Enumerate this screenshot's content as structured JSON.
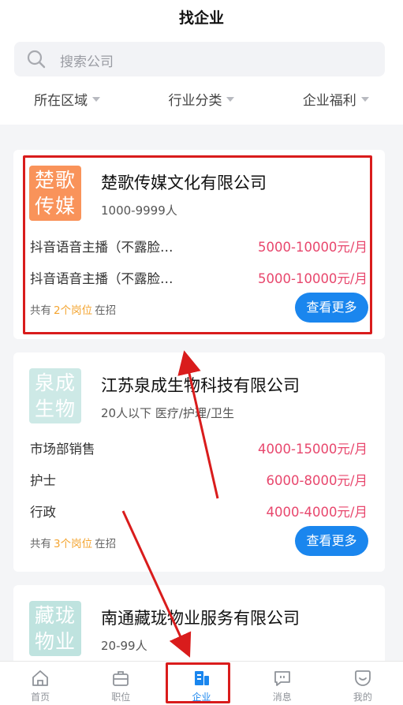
{
  "header": {
    "title": "找企业"
  },
  "search": {
    "placeholder": "搜索公司"
  },
  "filters": [
    {
      "label": "所在区域"
    },
    {
      "label": "行业分类"
    },
    {
      "label": "企业福利"
    }
  ],
  "companies": [
    {
      "logo_line1": "楚歌",
      "logo_line2": "传媒",
      "logo_color": "#f9935a",
      "name": "楚歌传媒文化有限公司",
      "meta": "1000-9999人",
      "jobs": [
        {
          "title": "抖音语音主播（不露脸…",
          "salary": "5000-10000元/月"
        },
        {
          "title": "抖音语音主播（不露脸…",
          "salary": "5000-10000元/月"
        }
      ],
      "summary_prefix": "共有",
      "summary_count": "2个岗位",
      "summary_suffix": "在招",
      "more_label": "查看更多"
    },
    {
      "logo_line1": "泉成",
      "logo_line2": "生物",
      "logo_color": "#cde9e6",
      "name": "江苏泉成生物科技有限公司",
      "meta": "20人以下  医疗/护理/卫生",
      "jobs": [
        {
          "title": "市场部销售",
          "salary": "4000-15000元/月"
        },
        {
          "title": "护士",
          "salary": "6000-8000元/月"
        },
        {
          "title": "行政",
          "salary": "4000-4000元/月"
        }
      ],
      "summary_prefix": "共有",
      "summary_count": "3个岗位",
      "summary_suffix": "在招",
      "more_label": "查看更多"
    },
    {
      "logo_line1": "藏珑",
      "logo_line2": "物业",
      "logo_color": "#bfe3df",
      "name": "南通藏珑物业服务有限公司",
      "meta": "20-99人"
    }
  ],
  "tabbar": [
    {
      "label": "首页",
      "icon": "home-icon"
    },
    {
      "label": "职位",
      "icon": "briefcase-icon"
    },
    {
      "label": "企业",
      "icon": "building-icon",
      "active": true
    },
    {
      "label": "消息",
      "icon": "message-icon"
    },
    {
      "label": "我的",
      "icon": "profile-icon"
    }
  ],
  "colors": {
    "accent": "#1a86ee",
    "salary": "#e8476d",
    "highlight": "#d91c1c",
    "count": "#f4a531"
  }
}
